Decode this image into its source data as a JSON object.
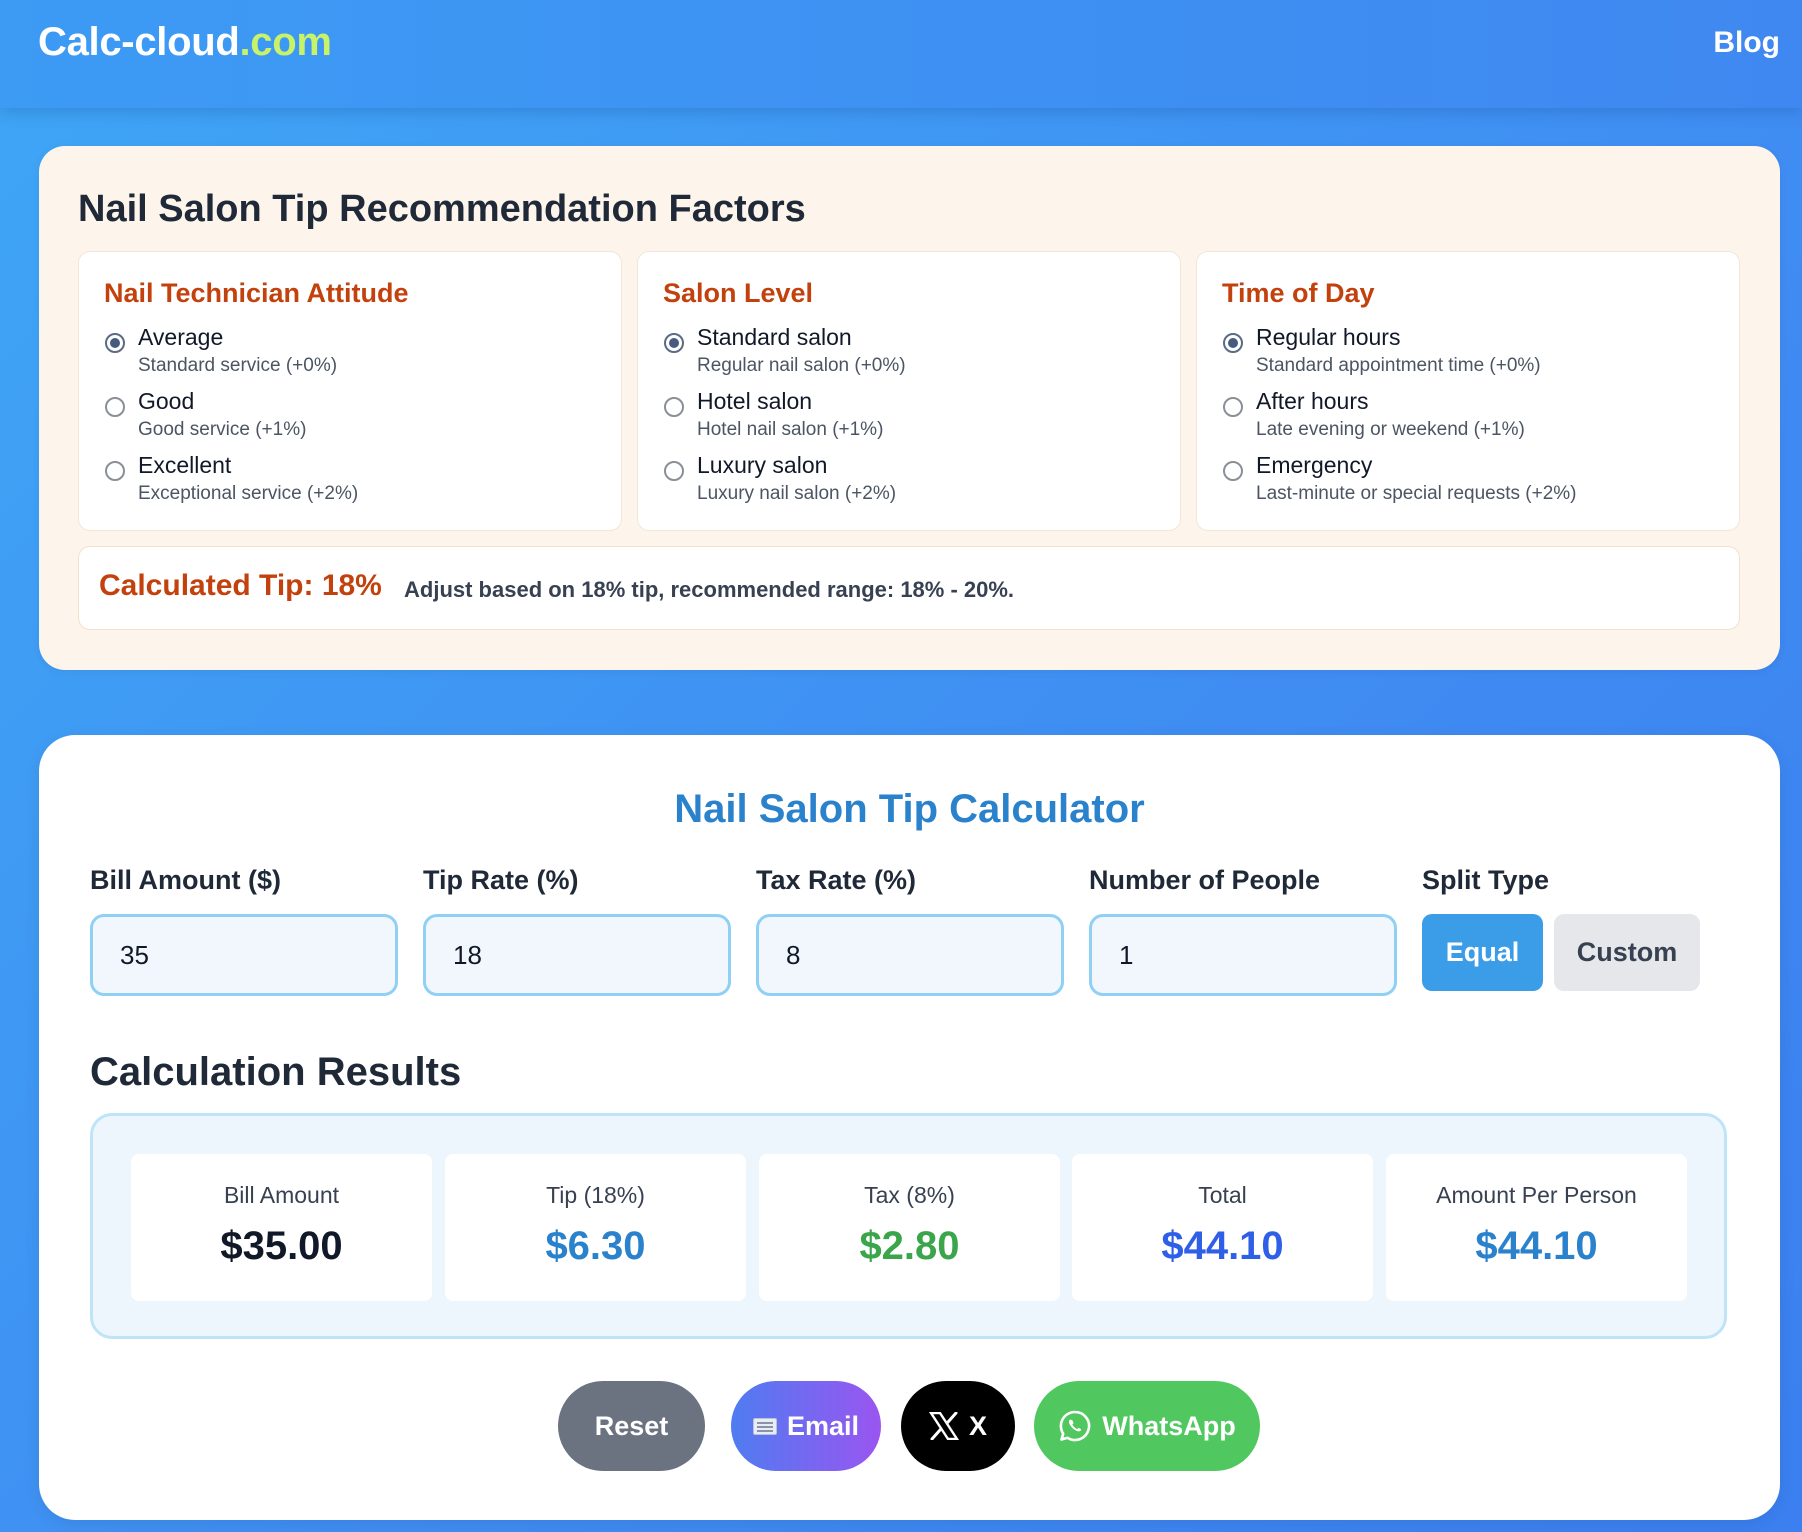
{
  "header": {
    "logo_main": "Calc-cloud",
    "logo_tld": ".com",
    "nav_blog": "Blog"
  },
  "factors": {
    "title": "Nail Salon Tip Recommendation Factors",
    "groups": [
      {
        "title": "Nail Technician Attitude",
        "options": [
          {
            "label": "Average",
            "desc": "Standard service (+0%)",
            "checked": true
          },
          {
            "label": "Good",
            "desc": "Good service (+1%)",
            "checked": false
          },
          {
            "label": "Excellent",
            "desc": "Exceptional service (+2%)",
            "checked": false
          }
        ]
      },
      {
        "title": "Salon Level",
        "options": [
          {
            "label": "Standard salon",
            "desc": "Regular nail salon (+0%)",
            "checked": true
          },
          {
            "label": "Hotel salon",
            "desc": "Hotel nail salon (+1%)",
            "checked": false
          },
          {
            "label": "Luxury salon",
            "desc": "Luxury nail salon (+2%)",
            "checked": false
          }
        ]
      },
      {
        "title": "Time of Day",
        "options": [
          {
            "label": "Regular hours",
            "desc": "Standard appointment time (+0%)",
            "checked": true
          },
          {
            "label": "After hours",
            "desc": "Late evening or weekend (+1%)",
            "checked": false
          },
          {
            "label": "Emergency",
            "desc": "Last-minute or special requests (+2%)",
            "checked": false
          }
        ]
      }
    ],
    "calculated_tip": "Calculated Tip: 18%",
    "tip_note": "Adjust based on 18% tip, recommended range: 18% - 20%."
  },
  "calculator": {
    "title": "Nail Salon Tip Calculator",
    "fields": [
      {
        "label": "Bill Amount ($)",
        "value": "35"
      },
      {
        "label": "Tip Rate (%)",
        "value": "18"
      },
      {
        "label": "Tax Rate (%)",
        "value": "8"
      },
      {
        "label": "Number of People",
        "value": "1"
      }
    ],
    "split_type_label": "Split Type",
    "split_equal": "Equal",
    "split_custom": "Custom",
    "split_selected": "Equal"
  },
  "results": {
    "title": "Calculation Results",
    "cards": [
      {
        "label": "Bill Amount",
        "value": "$35.00",
        "color": "#111827"
      },
      {
        "label": "Tip (18%)",
        "value": "$6.30",
        "color": "#2b82cc"
      },
      {
        "label": "Tax (8%)",
        "value": "$2.80",
        "color": "#3aa54a"
      },
      {
        "label": "Total",
        "value": "$44.10",
        "color": "#2f5fe6"
      },
      {
        "label": "Amount Per Person",
        "value": "$44.10",
        "color": "#2b82cc"
      }
    ]
  },
  "actions": {
    "reset": "Reset",
    "email": "Email",
    "x": "X",
    "whatsapp": "WhatsApp"
  },
  "colors": {
    "accent_orange": "#c2410c",
    "accent_blue": "#3b9ce8",
    "whatsapp_green": "#50c85f"
  }
}
